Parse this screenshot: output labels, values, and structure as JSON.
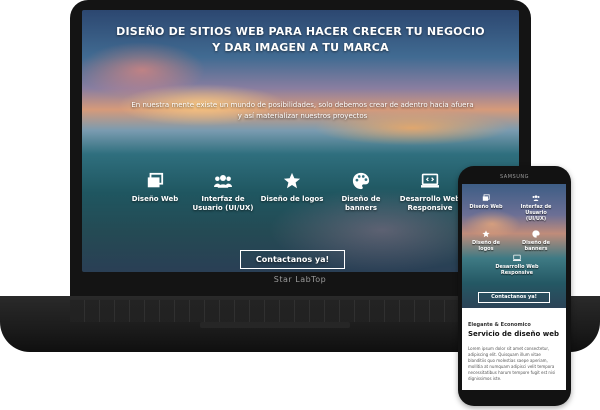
{
  "laptop": {
    "hero_title_line1": "DISEÑO DE SITIOS WEB PARA HACER CRECER TU NEGOCIO",
    "hero_title_line2": "Y DAR IMAGEN A TU MARCA",
    "hero_sub_line1": "En nuestra mente existe un mundo de posibilidades, solo debemos crear de adentro hacia afuera",
    "hero_sub_line2": "y así materializar nuestros proyectos",
    "features": [
      {
        "icon": "window-icon",
        "label": "Diseño Web"
      },
      {
        "icon": "users-icon",
        "label": "Interfaz de Usuario (UI/UX)"
      },
      {
        "icon": "star-icon",
        "label": "Diseño de logos"
      },
      {
        "icon": "palette-icon",
        "label": "Diseño de banners"
      },
      {
        "icon": "code-icon",
        "label": "Desarrollo Web Responsive"
      }
    ],
    "cta": "Contactanos ya!",
    "brand_label": "Star LabTop"
  },
  "phone": {
    "brand": "SAMSUNG",
    "features": [
      {
        "icon": "window-icon",
        "label": "Diseño Web"
      },
      {
        "icon": "users-icon",
        "label": "Interfaz de Usuario (UI/UX)"
      },
      {
        "icon": "star-icon",
        "label": "Diseño de logos"
      },
      {
        "icon": "palette-icon",
        "label": "Diseño de banners"
      },
      {
        "icon": "code-icon",
        "label": "Desarrollo Web Responsive"
      }
    ],
    "cta": "Contactanos ya!",
    "kicker": "Elegante & Economico",
    "heading": "Servicio de diseño web",
    "body": "Lorem ipsum dolor sit amet consectetur, adipiscing elit. Quisquam illum vitae blanditiis quo molestias saepe aperiam, mollitia at numquam adipisci velit tempora necessitatibus harum tempore fugit est nisi dignissimos iste."
  }
}
